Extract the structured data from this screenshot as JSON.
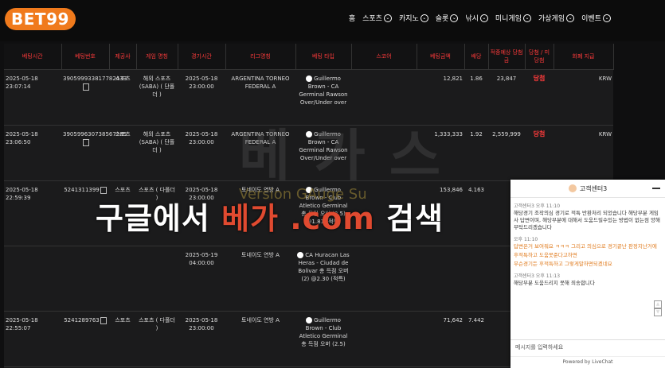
{
  "logo": {
    "text": "BET",
    "num": "99"
  },
  "nav": [
    {
      "label": "홈",
      "chev": false
    },
    {
      "label": "스포츠",
      "chev": true
    },
    {
      "label": "카지노",
      "chev": true
    },
    {
      "label": "슬롯",
      "chev": true
    },
    {
      "label": "낚시",
      "chev": true
    },
    {
      "label": "미니게임",
      "chev": true
    },
    {
      "label": "가상게임",
      "chev": true
    },
    {
      "label": "이벤트",
      "chev": true
    }
  ],
  "columns": [
    "베팅시간",
    "베팅번호",
    "제공사",
    "게임 명칭",
    "경기시간",
    "리그명칭",
    "베팅 타입",
    "스코어",
    "베팅금액",
    "배당",
    "적중예상 당첨금",
    "당첨 / 미당첨",
    "화폐 지급"
  ],
  "rows": [
    {
      "time": "2025-05-18 23:07:14",
      "no": "390599933817782433",
      "provider": "스포츠",
      "game": "해외 스포츠 (SABA) ( 단폴더 )",
      "match_time": "2025-05-18 23:00:00",
      "league": "ARGENTINA TORNEO FEDERAL A",
      "type": "Guillermo Brown - CA Germinal Rawson Over/Under over",
      "score": "",
      "amount": "12,821",
      "odds": "1.86",
      "expected": "23,847",
      "result": "당첨",
      "currency": "KRW"
    },
    {
      "time": "2025-05-18 23:06:50",
      "no": "390599630738567285",
      "provider": "스포츠",
      "game": "해외 스포츠 (SABA) ( 단폴더 )",
      "match_time": "2025-05-18 23:00:00",
      "league": "ARGENTINA TORNEO FEDERAL A",
      "type": "Guillermo Brown - CA Germinal Rawson Over/Under over",
      "score": "",
      "amount": "1,333,333",
      "odds": "1.92",
      "expected": "2,559,999",
      "result": "당첨",
      "currency": "KRW"
    },
    {
      "time": "2025-05-18 22:59:39",
      "no": "5241311399",
      "provider": "스포츠",
      "game": "스포츠 ( 다폴더 )",
      "match_time": "2025-05-18 23:00:00",
      "league": "토네이도 연방 A",
      "type": "Guillermo Brown - Club Atletico Germinal 총 득점 오버 (2.5) @1.81 (적특)",
      "score": "",
      "amount": "153,846",
      "odds": "4.163",
      "expected": "",
      "result": "",
      "currency": ""
    },
    {
      "time": "",
      "no": "",
      "provider": "",
      "game": "",
      "match_time": "2025-05-19 04:00:00",
      "league": "토네이도 연방 A",
      "type": "CA Huracan Las Heras - Ciudad de Bolivar 총 득점 오버 (2) @2.30 (적특)",
      "score": "",
      "amount": "",
      "odds": "",
      "expected": "",
      "result": "",
      "currency": ""
    },
    {
      "time": "2025-05-18 22:55:07",
      "no": "5241289763",
      "provider": "스포츠",
      "game": "스포츠 ( 다폴더 )",
      "match_time": "2025-05-18 23:00:00",
      "league": "토네이도 연방 A",
      "type": "Guillermo Brown - Club Atletico Germinal 총 득점 오버 (2.5)",
      "score": "",
      "amount": "71,642",
      "odds": "7.442",
      "expected": "",
      "result": "",
      "currency": ""
    }
  ],
  "watermark": {
    "prefix": "구글에서 ",
    "highlight": "베가 .com",
    "suffix": " 검색",
    "bg": "베가스",
    "sub": "Version GAuge Su"
  },
  "chat": {
    "title": "고객센터3",
    "messages": [
      {
        "meta": "고객센터3 오후 11:10",
        "text": "해당경기 조작의심 경기로 적특 반환처리 되었습니다 해당부분 게임사 답변이며, 해당부분에 대해서 도움드릴수있는 방법이 없는점 양해부탁드리겠습니다",
        "orange": false
      },
      {
        "meta": "오후 11:10",
        "text": "답변온거 보여줘요 ㅋㅋㅋ 그리고 의심으로 경기끝난 판정지난거에",
        "orange": true
      },
      {
        "meta": "",
        "text": "후적특하고 도움못준다고하면",
        "orange": true
      },
      {
        "meta": "",
        "text": "무슨경기든 후적특하고 그렇게말하면되겠네요",
        "orange": true
      },
      {
        "meta": "고객센터3 오후 11:13",
        "text": "해당부분 도움드리지 못해 죄송합니다",
        "orange": false
      }
    ],
    "input_placeholder": "메시지를 입력하세요",
    "footer": "Powered by LiveChat"
  }
}
